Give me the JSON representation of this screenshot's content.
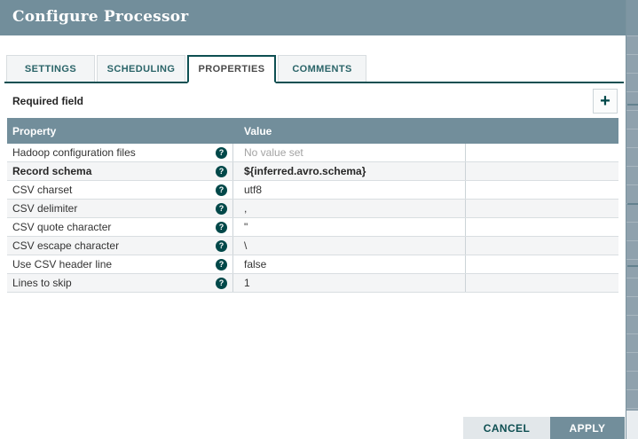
{
  "dialog": {
    "title": "Configure Processor"
  },
  "tabs": [
    {
      "label": "SETTINGS"
    },
    {
      "label": "SCHEDULING"
    },
    {
      "label": "PROPERTIES",
      "active": true
    },
    {
      "label": "COMMENTS"
    }
  ],
  "properties_panel": {
    "required_field_label": "Required field"
  },
  "icons": {
    "add_glyph": "+",
    "help_glyph": "?"
  },
  "table": {
    "columns": [
      "Property",
      "Value"
    ],
    "rows": [
      {
        "property": "Hadoop configuration files",
        "value": "No value set"
      },
      {
        "property": "Record schema",
        "value": "${inferred.avro.schema}"
      },
      {
        "property": "CSV charset",
        "value": "utf8"
      },
      {
        "property": "CSV delimiter",
        "value": ","
      },
      {
        "property": "CSV quote character",
        "value": "\""
      },
      {
        "property": "CSV escape character",
        "value": "\\"
      },
      {
        "property": "Use CSV header line",
        "value": "false"
      },
      {
        "property": "Lines to skip",
        "value": "1"
      }
    ]
  },
  "buttons": {
    "cancel": "CANCEL",
    "apply": "APPLY"
  },
  "colors": {
    "header_bg": "#728E9B",
    "accent_teal": "#004849",
    "row_alt": "#F4F5F6",
    "tab_border": "#0E4F52"
  }
}
